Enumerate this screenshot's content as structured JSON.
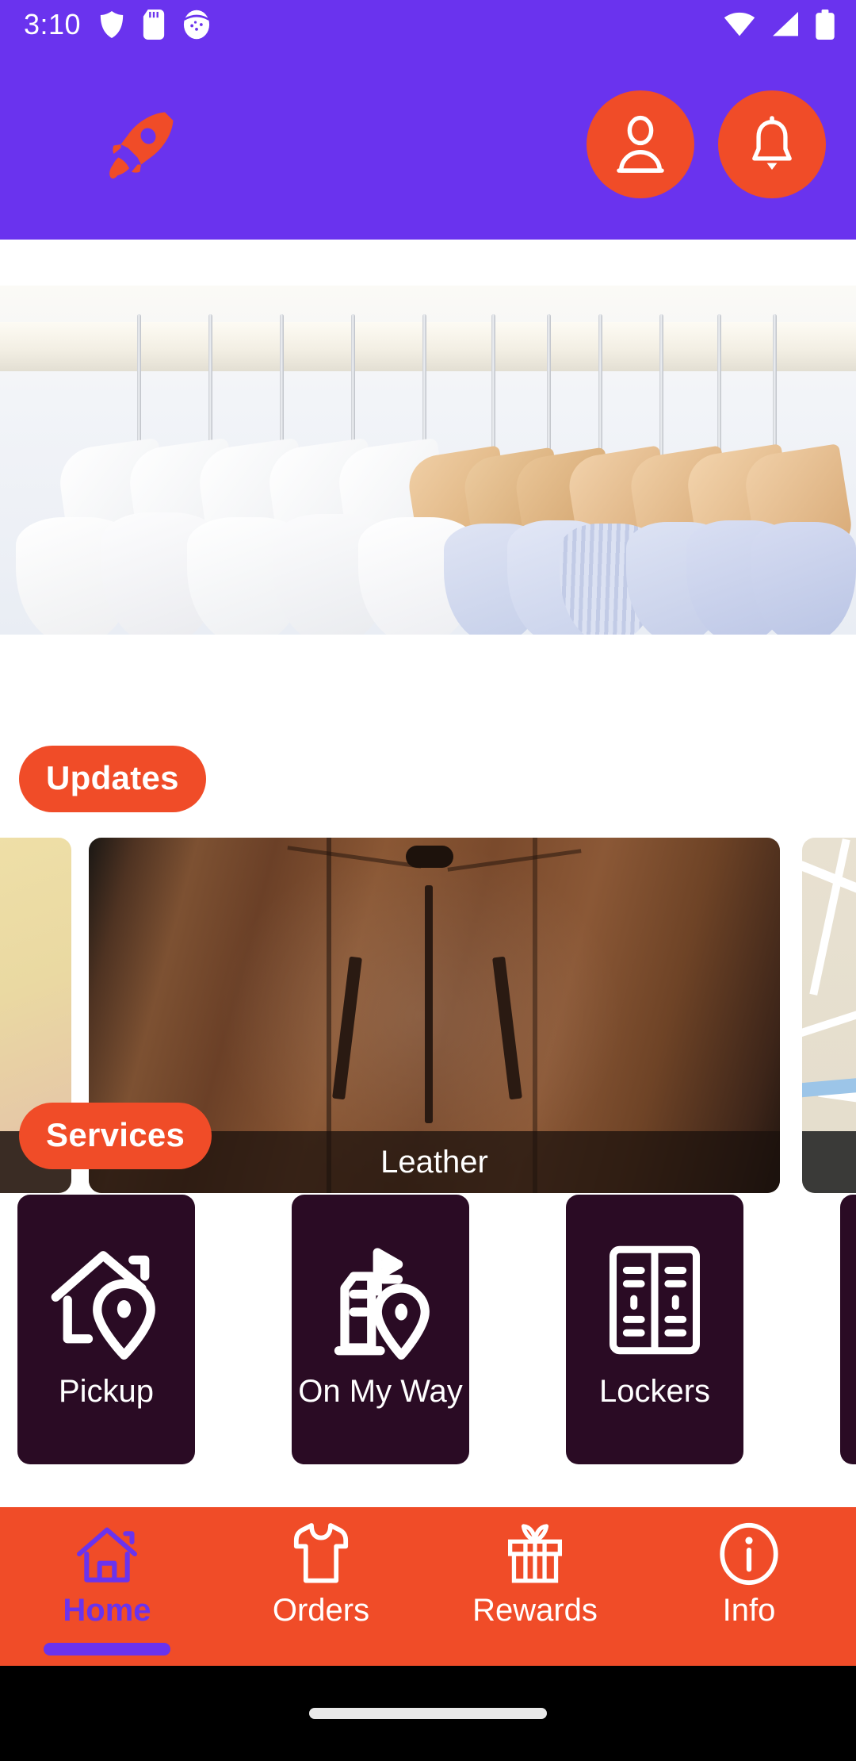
{
  "status_bar": {
    "time": "3:10",
    "left_icons": [
      "shield-icon",
      "sd-card-icon",
      "app-badge-icon"
    ],
    "right_icons": [
      "wifi-icon",
      "cellular-signal-icon",
      "battery-icon"
    ]
  },
  "header": {
    "logo": "rocket-logo",
    "account_button": "account-icon",
    "notification_button": "bell-icon"
  },
  "hero": {
    "alt": "shirts-on-hangers-banner"
  },
  "updates": {
    "section_label": "Updates",
    "cards": [
      {
        "caption": "",
        "kind": "partial-left"
      },
      {
        "caption": "Leather",
        "kind": "leather-jacket"
      },
      {
        "caption": "",
        "kind": "map-partial-right"
      }
    ]
  },
  "services": {
    "section_label": "Services",
    "items": [
      {
        "label": "Pickup",
        "icon": "house-pin-icon"
      },
      {
        "label": "On My Way",
        "icon": "building-pin-icon"
      },
      {
        "label": "Lockers",
        "icon": "lockers-icon"
      },
      {
        "label": "",
        "icon": ""
      }
    ]
  },
  "bottom_nav": {
    "items": [
      {
        "label": "Home",
        "icon": "home-icon",
        "active": true
      },
      {
        "label": "Orders",
        "icon": "shirt-icon",
        "active": false
      },
      {
        "label": "Rewards",
        "icon": "gift-icon",
        "active": false
      },
      {
        "label": "Info",
        "icon": "info-icon",
        "active": false
      }
    ]
  },
  "colors": {
    "primary_purple": "#6A33EE",
    "accent_orange": "#F04C28",
    "service_card": "#2A0B24",
    "gesture_bar": "#000000"
  }
}
